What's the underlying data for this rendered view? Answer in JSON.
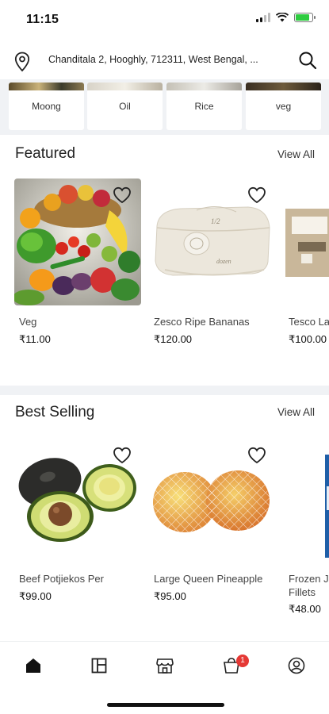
{
  "status_bar": {
    "time": "11:15"
  },
  "location": {
    "address": "Chanditala 2, Hooghly, 712311, West Bengal, ..."
  },
  "categories": [
    {
      "label": "Moong"
    },
    {
      "label": "Oil"
    },
    {
      "label": "Rice"
    },
    {
      "label": "veg"
    }
  ],
  "featured": {
    "title": "Featured",
    "view_all": "View All",
    "products": [
      {
        "name": "Veg",
        "price": "₹11.00"
      },
      {
        "name": "Zesco Ripe Bananas",
        "price": "₹120.00"
      },
      {
        "name": "Tesco La",
        "price": "₹100.00"
      }
    ]
  },
  "best_selling": {
    "title": "Best Selling",
    "view_all": "View All",
    "products": [
      {
        "name": "Beef Potjiekos Per",
        "price": "₹99.00"
      },
      {
        "name": "Large Queen Pineapple",
        "price": "₹95.00"
      },
      {
        "name": "Frozen J",
        "name_line2": "Fillets",
        "price": "₹48.00"
      }
    ]
  },
  "bottom_nav": {
    "items": [
      {
        "icon": "home-icon",
        "active": true
      },
      {
        "icon": "categories-icon",
        "active": false
      },
      {
        "icon": "store-icon",
        "active": false
      },
      {
        "icon": "cart-icon",
        "active": false,
        "badge": "1"
      },
      {
        "icon": "profile-icon",
        "active": false
      }
    ]
  },
  "colors": {
    "accent": "#e53935",
    "background": "#ffffff",
    "band": "#f0f2f5"
  }
}
